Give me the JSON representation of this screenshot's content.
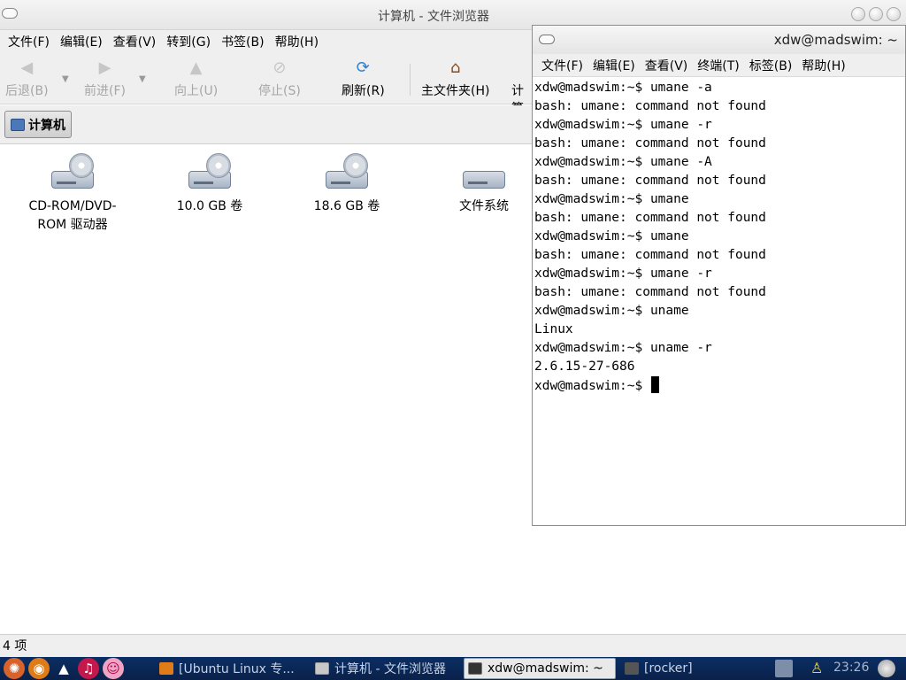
{
  "file_browser": {
    "title": "计算机 - 文件浏览器",
    "menu": [
      "文件(F)",
      "编辑(E)",
      "查看(V)",
      "转到(G)",
      "书签(B)",
      "帮助(H)"
    ],
    "toolbar": {
      "back": "后退(B)",
      "forward": "前进(F)",
      "up": "向上(U)",
      "stop": "停止(S)",
      "reload": "刷新(R)",
      "home": "主文件夹(H)",
      "computer": "计算"
    },
    "location": "计算机",
    "items": [
      {
        "line1": "CD-ROM/DVD-",
        "line2": "ROM 驱动器"
      },
      {
        "line1": "10.0 GB 卷",
        "line2": ""
      },
      {
        "line1": "18.6 GB 卷",
        "line2": ""
      },
      {
        "line1": "文件系统",
        "line2": ""
      }
    ],
    "status": "4 项"
  },
  "terminal": {
    "title": "xdw@madswim: ~",
    "menu": [
      "文件(F)",
      "编辑(E)",
      "查看(V)",
      "终端(T)",
      "标签(B)",
      "帮助(H)"
    ],
    "lines": [
      "xdw@madswim:~$ umane -a",
      "bash: umane: command not found",
      "xdw@madswim:~$ umane -r",
      "bash: umane: command not found",
      "xdw@madswim:~$ umane -A",
      "bash: umane: command not found",
      "xdw@madswim:~$ umane",
      "bash: umane: command not found",
      "xdw@madswim:~$ umane",
      "bash: umane: command not found",
      "xdw@madswim:~$ umane -r",
      "bash: umane: command not found",
      "xdw@madswim:~$ uname",
      "Linux",
      "xdw@madswim:~$ uname -r",
      "2.6.15-27-686",
      "xdw@madswim:~$ "
    ]
  },
  "taskbar": {
    "tasks": [
      "[Ubuntu Linux 专...",
      "计算机 - 文件浏览器",
      "xdw@madswim: ~",
      "[rocker]"
    ],
    "clock": "23:26"
  },
  "colors": {
    "taskbar": "#0a214a",
    "window_bg": "#efefef"
  }
}
